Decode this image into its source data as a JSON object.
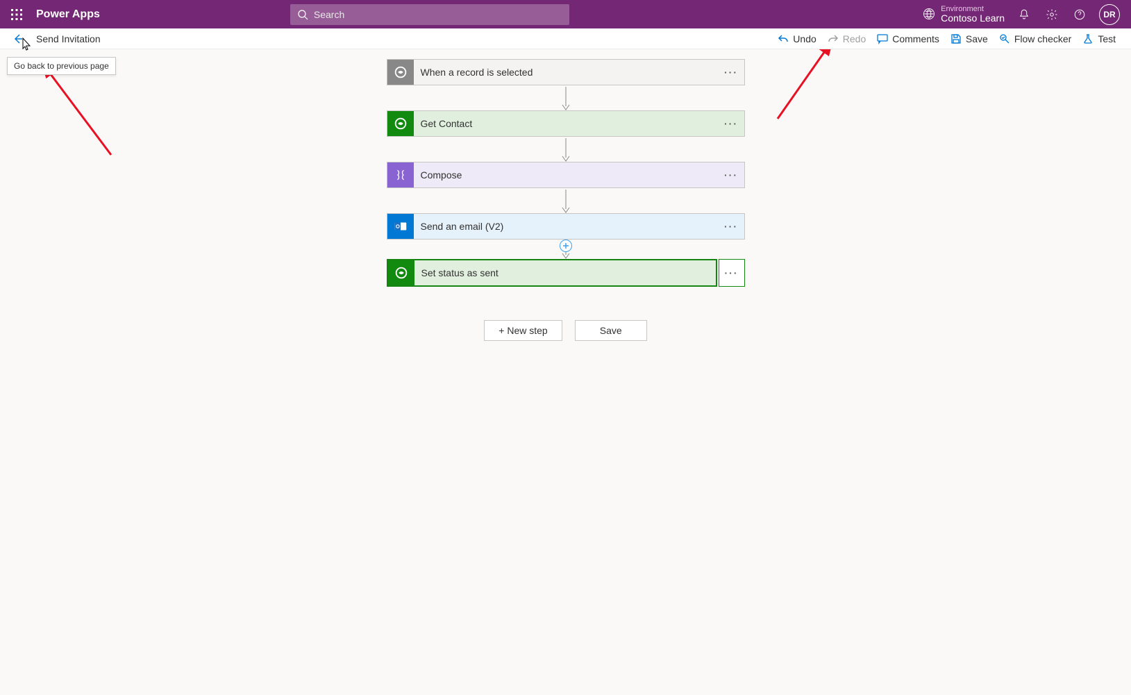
{
  "header": {
    "app_title": "Power Apps",
    "search_placeholder": "Search",
    "environment_label": "Environment",
    "environment_name": "Contoso Learn",
    "avatar_initials": "DR"
  },
  "cmdbar": {
    "flow_name": "Send Invitation",
    "undo": "Undo",
    "redo": "Redo",
    "comments": "Comments",
    "save": "Save",
    "flow_checker": "Flow checker",
    "test": "Test",
    "back_tooltip": "Go back to previous page"
  },
  "steps": [
    {
      "title": "When a record is selected"
    },
    {
      "title": "Get Contact"
    },
    {
      "title": "Compose"
    },
    {
      "title": "Send an email (V2)"
    },
    {
      "title": "Set status as sent"
    }
  ],
  "buttons": {
    "new_step": "+ New step",
    "save": "Save"
  }
}
